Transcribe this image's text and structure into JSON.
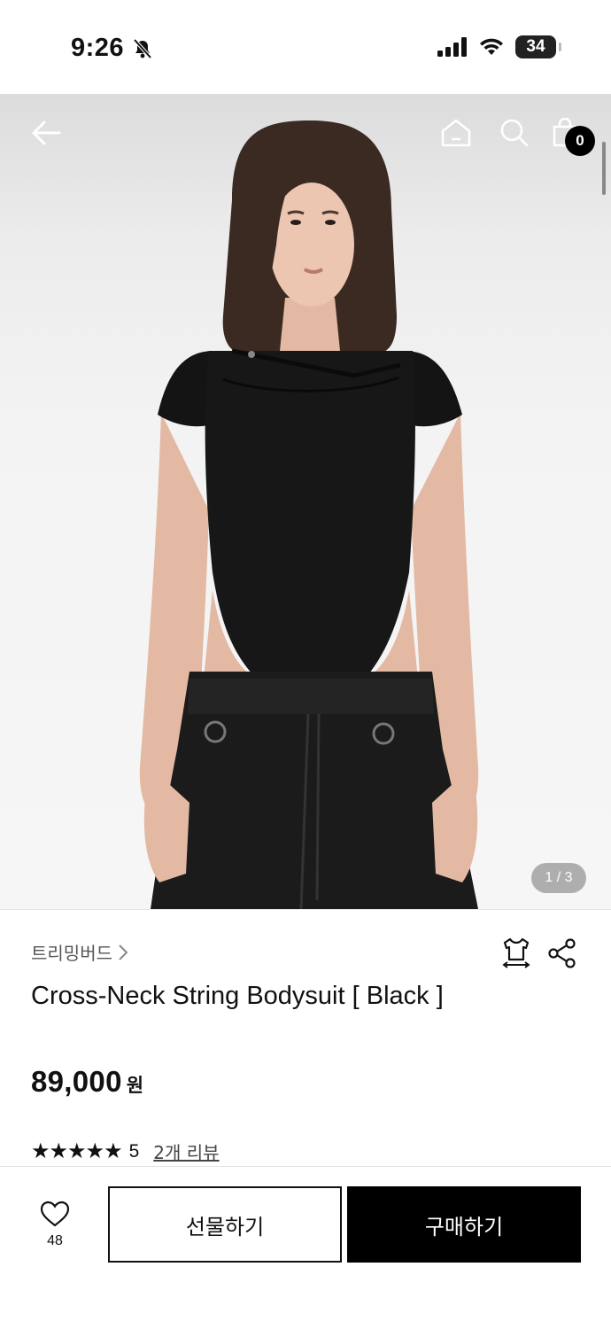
{
  "status": {
    "time": "9:26",
    "battery": "34"
  },
  "hero": {
    "counter": "1 / 3",
    "cart_count": "0"
  },
  "product": {
    "brand": "트리밍버드",
    "title": "Cross-Neck String Bodysuit [ Black ]",
    "price": "89,000",
    "currency": "원",
    "stars": "★★★★★",
    "rating": "5",
    "review_link": "2개 리뷰"
  },
  "actions": {
    "like_count": "48",
    "gift_label": "선물하기",
    "buy_label": "구매하기"
  },
  "colors": {
    "accent": "#000000",
    "background": "#ffffff",
    "text": "#111111"
  }
}
